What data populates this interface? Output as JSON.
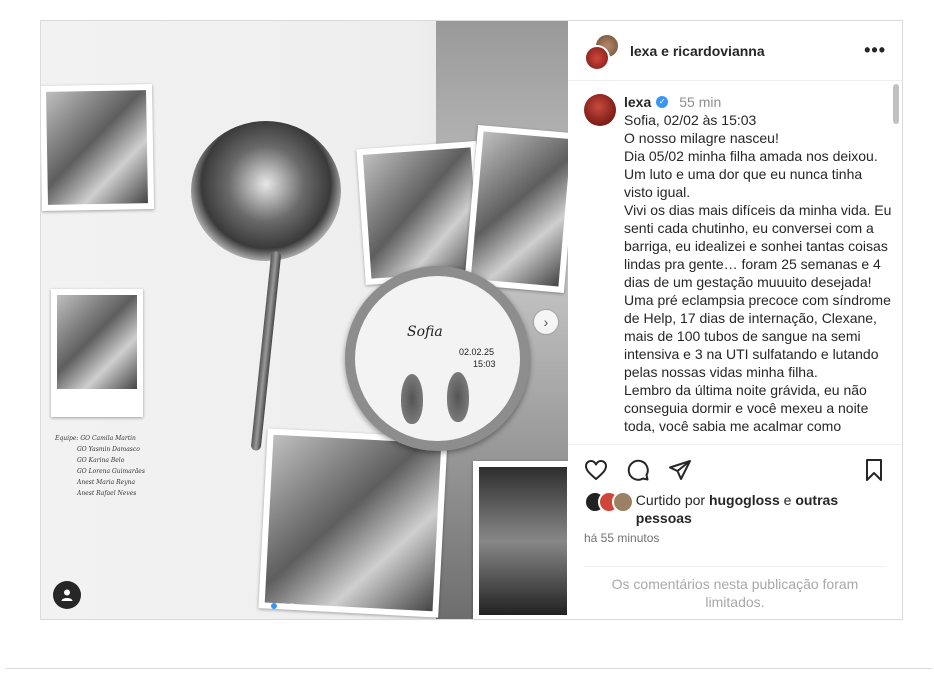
{
  "header": {
    "accounts": "lexa e ricardovianna",
    "more_icon": "more-horizontal-icon"
  },
  "caption": {
    "username": "lexa",
    "time_ago": "55 min",
    "text": "Sofia, 02/02 às 15:03\nO nosso milagre nasceu!\nDia 05/02 minha filha amada nos deixou. Um luto e uma dor que eu nunca tinha visto igual.\nVivi os dias mais difíceis da minha vida. Eu senti cada chutinho, eu conversei com a barriga, eu idealizei e sonhei tantas coisas lindas pra gente… foram 25 semanas e 4 dias de um gestação muuuito desejada! Uma pré eclampsia precoce com síndrome de Help, 17 dias de internação, Clexane, mais de 100 tubos de sangue na semi intensiva e 3 na UTI sulfatando e lutando pelas nossas vidas minha filha.\nLembro da última noite grávida, eu não conseguia dormir e você mexeu a noite toda, você sabia me acalmar como"
  },
  "likes": {
    "prefix": "Curtido por ",
    "user": "hugogloss",
    "middle": " e ",
    "others": "outras pessoas"
  },
  "posted_ago": "há 55 minutos",
  "comments_limited": "Os comentários nesta publicação foram limitados.",
  "media": {
    "embroidery_name": "Sofia",
    "embroidery_date": "02.02.25",
    "embroidery_time": "15:03",
    "handwritten_list": [
      "Equipe: GO Camila Martin",
      "GO Yasmin Damasco",
      "GO Karina Belo",
      "GO Lorena Guimarães",
      "Anest Maria Reyna",
      "Anest Rafael Neves"
    ]
  },
  "colors": {
    "accent": "#3897f0",
    "text": "#262626",
    "muted": "#8e8e8e"
  }
}
